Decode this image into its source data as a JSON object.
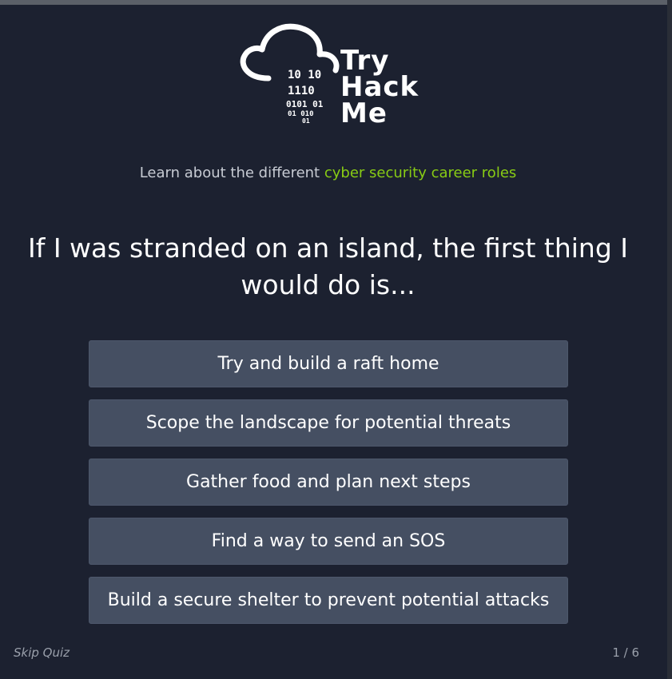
{
  "brand": {
    "name_lines": [
      "Try",
      "Hack",
      "Me"
    ],
    "binary_lines": [
      "10  10",
      "1110",
      "0101  01",
      "01  010",
      "01"
    ]
  },
  "tagline": {
    "prefix": "Learn about the different ",
    "highlight": "cyber security career roles",
    "accent_color": "#88cc14"
  },
  "question": {
    "text": "If I was stranded on an island, the first thing I would do is..."
  },
  "answers": [
    {
      "label": "Try and build a raft home"
    },
    {
      "label": "Scope the landscape for potential threats"
    },
    {
      "label": "Gather food and plan next steps"
    },
    {
      "label": "Find a way to send an SOS"
    },
    {
      "label": "Build a secure shelter to prevent potential attacks"
    }
  ],
  "footer": {
    "skip_label": "Skip Quiz",
    "progress": "1 / 6"
  }
}
